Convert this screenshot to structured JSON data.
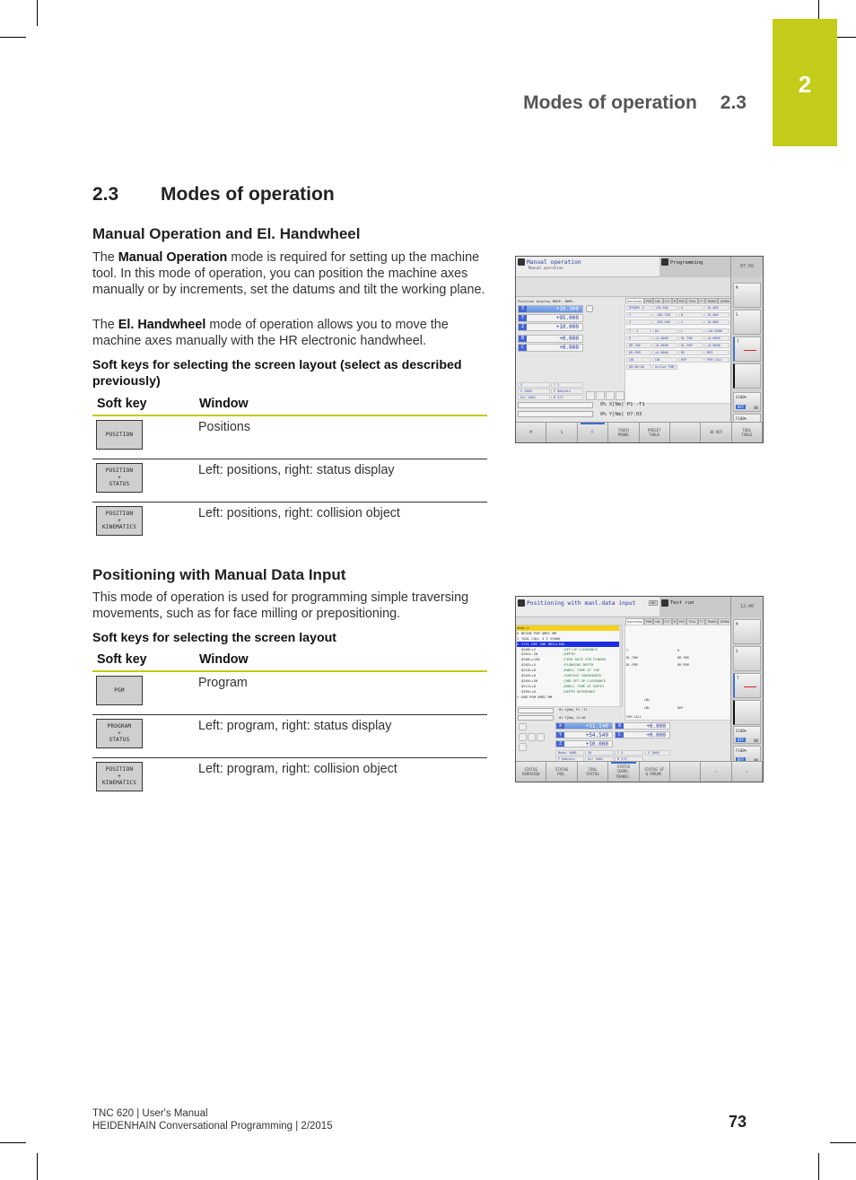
{
  "running_head": {
    "title": "Modes of operation",
    "number": "2.3"
  },
  "chapter_tab": {
    "number": "2",
    "color": "#c3cc19"
  },
  "section": {
    "number": "2.3",
    "title": "Modes of operation"
  },
  "manual": {
    "heading": "Manual Operation and El. Handwheel",
    "p1_pre": "The ",
    "p1_bold": "Manual Operation",
    "p1_post": " mode is required for setting up the machine tool. In this mode of operation, you can position the machine axes manually or by increments, set the datums and tilt the working plane.",
    "p2_pre": "The ",
    "p2_bold": "El. Handwheel",
    "p2_post": " mode of operation allows you to move the machine axes manually with the HR electronic handwheel.",
    "softkey_heading": "Soft keys for selecting the screen layout (select as described previously)",
    "table": {
      "col_softkey": "Soft key",
      "col_window": "Window",
      "rows": [
        {
          "key_lines": [
            "POSITION"
          ],
          "window": "Positions"
        },
        {
          "key_lines": [
            "POSITION",
            "+",
            "STATUS"
          ],
          "window": "Left: positions, right: status display"
        },
        {
          "key_lines": [
            "POSITION",
            "+",
            "KINEMATICS"
          ],
          "window": "Left: positions, right: collision object"
        }
      ]
    }
  },
  "mdi": {
    "heading": "Positioning with Manual Data Input",
    "paragraph": "This mode of operation is used for programming simple traversing movements, such as for face milling or prepositioning.",
    "softkey_heading": "Soft keys for selecting the screen layout",
    "table": {
      "col_softkey": "Soft key",
      "col_window": "Window",
      "rows": [
        {
          "key_lines": [
            "PGM"
          ],
          "window": "Program"
        },
        {
          "key_lines": [
            "PROGRAM",
            "+",
            "STATUS"
          ],
          "window": "Left: program, right: status display"
        },
        {
          "key_lines": [
            "POSITION",
            "+",
            "KINEMATICS"
          ],
          "window": "Left: program, right: collision object"
        }
      ]
    }
  },
  "screen1": {
    "mode": "Manual operation",
    "submode": "Manual operation",
    "right_mode": "Programming",
    "clock": "07:56",
    "position_display": "Position display MODE: NOML.",
    "axes": [
      {
        "letter": "X",
        "value": "+10.300",
        "selected": true
      },
      {
        "letter": "Y",
        "value": "+95.000",
        "selected": false
      },
      {
        "letter": "Z",
        "value": "+10.000",
        "selected": false
      },
      {
        "letter": "B",
        "value": "+0.000",
        "selected": false
      },
      {
        "letter": "C",
        "value": "+0.000",
        "selected": false
      }
    ],
    "status_tabs": [
      "Overview",
      "PGM",
      "LBL",
      "CYC",
      "M",
      "POS",
      "TOOL",
      "TT",
      "TRANS",
      "QPARA"
    ],
    "status_cells": [
      "RFNOML X",
      "110.500",
      "A",
      "10.000",
      "Y",
      "-105.330",
      "B",
      "10.000",
      "Z",
      "-250.000",
      "C",
      "10.000",
      "T : 2",
      "D4",
      "L",
      "+40.0000",
      "R",
      "+2.0000",
      "DL-TAB",
      "+0.0000",
      "DR-TAB",
      "+0.0000",
      "DL-PGM",
      "+0.0000",
      "DR-PGM",
      "+0.0000",
      "M5",
      "M93",
      "LBL",
      "LBL",
      "REP",
      "PGM CALL",
      "00:00:00",
      "Active PGM:"
    ],
    "info_left": [
      "S",
      "T 2",
      "S 2000",
      "F 0mm/min",
      "Ovr 100%",
      "M 5/9"
    ],
    "load_lines": [
      "0% X[Nm] P1  -T1",
      "0% Y[Nm] 07:03"
    ],
    "side_labels": [
      "M",
      "S",
      "T"
    ],
    "overrides": [
      {
        "label": "S100%",
        "off": "OFF",
        "on": "ON"
      },
      {
        "label": "F100%",
        "off": "OFF",
        "on": "ON"
      }
    ],
    "softkeys": [
      {
        "lines": [
          "M"
        ],
        "active": false
      },
      {
        "lines": [
          "S"
        ],
        "active": false
      },
      {
        "lines": [
          "F"
        ],
        "active": true
      },
      {
        "lines": [
          "TOUCH",
          "PROBE"
        ],
        "active": false
      },
      {
        "lines": [
          "PRESET",
          "TABLE"
        ],
        "active": false
      },
      {
        "lines": [
          ""
        ],
        "active": false
      },
      {
        "lines": [
          "3D ROT"
        ],
        "active": false
      },
      {
        "lines": [
          "TOOL",
          "TABLE"
        ],
        "active": false
      }
    ]
  },
  "screen2": {
    "mode": "Positioning with manl.data input",
    "right_mode": "Test run",
    "dnc": "DNC",
    "clock": "12:40",
    "file": "$mdi.h",
    "program": [
      {
        "n": "0",
        "code": "BEGIN PGM $MDI MM",
        "comment": "",
        "cls": ""
      },
      {
        "n": "1",
        "code": "TOOL CALL 4 Z S3000",
        "comment": "",
        "cls": ""
      },
      {
        "n": "2",
        "code": "CYCL DEF 200 DRILLING",
        "comment": "",
        "cls": "cur"
      },
      {
        "n": "",
        "code": "  Q200=+2",
        "comment": ";SET-UP CLEARANCE",
        "cls": ""
      },
      {
        "n": "",
        "code": "  Q201=-20",
        "comment": ";DEPTH",
        "cls": ""
      },
      {
        "n": "",
        "code": "  Q206=+150",
        "comment": ";FEED RATE FOR PLNGNG",
        "cls": ""
      },
      {
        "n": "",
        "code": "  Q202=+5",
        "comment": ";PLUNGING DEPTH",
        "cls": ""
      },
      {
        "n": "",
        "code": "  Q210=+0",
        "comment": ";DWELL TIME AT TOP",
        "cls": ""
      },
      {
        "n": "",
        "code": "  Q203=+0",
        "comment": ";SURFACE COORDINATE",
        "cls": ""
      },
      {
        "n": "",
        "code": "  Q204=+50",
        "comment": ";2ND SET-UP CLEARANCE",
        "cls": ""
      },
      {
        "n": "",
        "code": "  Q211=+0",
        "comment": ";DWELL TIME AT DEPTH",
        "cls": ""
      },
      {
        "n": "",
        "code": "  Q395=+0",
        "comment": ";DEPTH REFERENCE",
        "cls": ""
      },
      {
        "n": "3",
        "code": "END PGM $MDI MM",
        "comment": "",
        "cls": ""
      }
    ],
    "load_lines": [
      "0% X[Nm] P1  -T1",
      "0% Y[Nm] 11:40"
    ],
    "status_tabs": [
      "Overview",
      "PGM",
      "LBL",
      "CYC",
      "M",
      "POS",
      "TOOL",
      "TT",
      "TRANS",
      "QPARA"
    ],
    "status_labels": [
      "T",
      "R",
      "DL-TAB",
      "DR-TAB",
      "DL-PGM",
      "DR-PGM",
      "LBL",
      "LBL",
      "REP",
      "PGM CALL"
    ],
    "axes": [
      {
        "letter": "X",
        "value": "+51.140",
        "selected": true
      },
      {
        "letter": "Y",
        "value": "+54.549",
        "selected": false
      },
      {
        "letter": "Z",
        "value": "+10.000",
        "selected": false
      },
      {
        "letter": "B",
        "value": "+0.000",
        "selected": false
      },
      {
        "letter": "C",
        "value": "+0.000",
        "selected": false
      }
    ],
    "info_row": [
      "Mode: NOML.",
      "S0",
      "T 4",
      "S 2000",
      "F 0mm/min",
      "Ovr 100%",
      "M 5/9"
    ],
    "side_labels": [
      "M",
      "S",
      "T"
    ],
    "overrides": [
      {
        "label": "S100%",
        "off": "OFF",
        "on": "ON"
      },
      {
        "label": "F100%",
        "off": "OFF",
        "on": "ON"
      }
    ],
    "softkeys": [
      {
        "lines": [
          "STATUS",
          "OVERVIEW"
        ],
        "active": false
      },
      {
        "lines": [
          "STATUS",
          "POS."
        ],
        "active": false
      },
      {
        "lines": [
          "TOOL",
          "STATUS"
        ],
        "active": false
      },
      {
        "lines": [
          "STATUS",
          "COORD.",
          "TRANSF."
        ],
        "active": true
      },
      {
        "lines": [
          "STATUS OF",
          "Q PARAM."
        ],
        "active": false
      },
      {
        "lines": [
          ""
        ],
        "active": false
      },
      {
        "lines": [
          "⇦"
        ],
        "active": false
      },
      {
        "lines": [
          "⇨"
        ],
        "active": false
      }
    ]
  },
  "footer": {
    "line1": "TNC 620 | User's Manual",
    "line2": "HEIDENHAIN Conversational Programming | 2/2015",
    "page": "73"
  }
}
